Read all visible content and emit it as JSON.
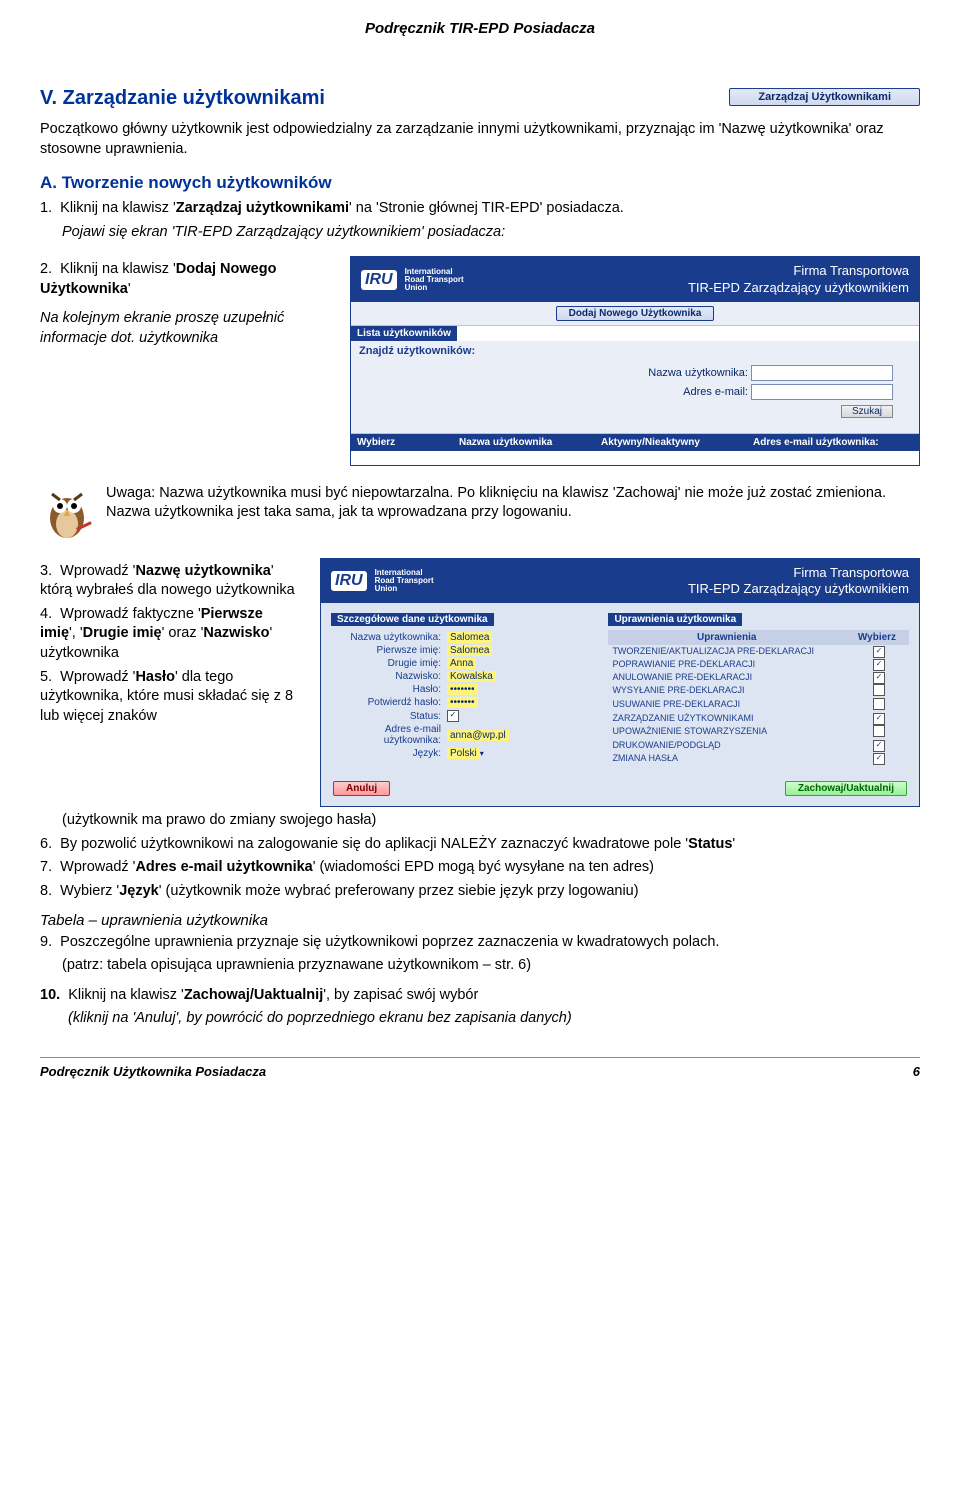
{
  "header": {
    "title": "Podręcznik TIR-EPD Posiadacza"
  },
  "section_v": {
    "heading": "V.  Zarządzanie użytkownikami",
    "manage_button": "Zarządzaj Użytkownikami",
    "intro": "Początkowo główny użytkownik jest odpowiedzialny za zarządzanie innymi użytkownikami, przyznając im 'Nazwę użytkownika' oraz stosowne uprawnienia."
  },
  "section_a": {
    "heading": "A.  Tworzenie nowych użytkowników",
    "step1_pre": "Kliknij na klawisz '",
    "step1_bold": "Zarządzaj użytkownikami",
    "step1_post": "' na 'Stronie głównej TIR-EPD' posiadacza.",
    "step1_result": "Pojawi się ekran 'TIR-EPD Zarządzający użytkownikiem' posiadacza:",
    "step2_pre": "Kliknij na klawisz '",
    "step2_bold": "Dodaj Nowego Użytkownika",
    "step2_after": "Na kolejnym ekranie proszę uzupełnić informacje dot. użytkownika"
  },
  "iru1": {
    "logo": "IRU",
    "logo_sub1": "International",
    "logo_sub2": "Road Transport",
    "logo_sub3": "Union",
    "firm": "Firma Transportowa",
    "subtitle": "TIR-EPD Zarządzający użytkownikiem",
    "add_user_btn": "Dodaj Nowego Użytkownika",
    "list_label": "Lista użytkowników",
    "find_label": "Znajdź użytkowników:",
    "name_label": "Nazwa użytkownika:",
    "email_label": "Adres e-mail:",
    "search_btn": "Szukaj",
    "th1": "Wybierz",
    "th2": "Nazwa użytkownika",
    "th3": "Aktywny/Nieaktywny",
    "th4": "Adres e-mail użytkownika:"
  },
  "note": {
    "label": "Uwaga:",
    "text": "Nazwa użytkownika musi być niepowtarzalna. Po kliknięciu na klawisz 'Zachowaj' nie może już zostać zmieniona. Nazwa użytkownika jest taka sama, jak ta wprowadzana przy logowaniu."
  },
  "steps_list": {
    "s3_pre": "Wprowadź '",
    "s3_bold": "Nazwę użytkownika",
    "s3_post": "' którą wybrałeś dla nowego użytkownika",
    "s4_pre": "Wprowadź faktyczne '",
    "s4_b1": "Pierwsze imię",
    "s4_mid1": "', '",
    "s4_b2": "Drugie imię",
    "s4_mid2": "' oraz '",
    "s4_b3": "Nazwisko",
    "s4_post": "' użytkownika",
    "s5_pre": "Wprowadź '",
    "s5_bold": "Hasło",
    "s5_post": "' dla tego użytkownika, które musi składać się z 8 lub więcej znaków",
    "s5_paren": "(użytkownik ma prawo do zmiany swojego hasła)",
    "s6_pre": "By pozwolić użytkownikowi na zalogowanie się do aplikacji NALEŻY zaznaczyć kwadratowe pole '",
    "s6_bold": "Status",
    "s6_post": "'",
    "s7_pre": "Wprowadź '",
    "s7_bold": "Adres e-mail użytkownika",
    "s7_post": "' (wiadomości EPD mogą być wysyłane na ten adres)",
    "s8_pre": "Wybierz '",
    "s8_bold": "Język",
    "s8_post": "' (użytkownik może wybrać preferowany przez siebie język przy logowaniu)"
  },
  "table_heading": "Tabela – uprawnienia użytkownika",
  "step9": "Poszczególne uprawnienia przyznaje się użytkownikowi poprzez zaznaczenia w kwadratowych polach.",
  "step9_paren": "(patrz: tabela opisująca uprawnienia przyznawane użytkownikom – str. 6)",
  "step10_pre": "Kliknij na klawisz '",
  "step10_bold": "Zachowaj/Uaktualnij",
  "step10_post": "', by zapisać swój wybór",
  "step10_paren": "(kliknij na 'Anuluj', by powrócić do poprzedniego ekranu bez zapisania danych)",
  "iru2": {
    "firm": "Firma Transportowa",
    "subtitle": "TIR-EPD Zarządzający użytkownikiem",
    "details_tag": "Szczegółowe dane użytkownika",
    "perm_tag": "Uprawnienia użytkownika",
    "fields": {
      "username_l": "Nazwa użytkownika:",
      "username_v": "Salomea",
      "first_l": "Pierwsze imię:",
      "first_v": "Salomea",
      "second_l": "Drugie imię:",
      "second_v": "Anna",
      "last_l": "Nazwisko:",
      "last_v": "Kowalska",
      "pass_l": "Hasło:",
      "pass_v": "•••••••",
      "pass2_l": "Potwierdź hasło:",
      "pass2_v": "•••••••",
      "status_l": "Status:",
      "email_l": "Adres e-mail użytkownika:",
      "email_v": "anna@wp.pl",
      "lang_l": "Język:",
      "lang_v": "Polski"
    },
    "perm_head_l": "Uprawnienia",
    "perm_head_r": "Wybierz",
    "perms": [
      {
        "label": "TWORZENIE/AKTUALIZACJA PRE-DEKLARACJI",
        "checked": true
      },
      {
        "label": "POPRAWIANIE PRE-DEKLARACJI",
        "checked": true
      },
      {
        "label": "ANULOWANIE PRE-DEKLARACJI",
        "checked": true
      },
      {
        "label": "WYSYŁANIE PRE-DEKLARACJI",
        "checked": false
      },
      {
        "label": "USUWANIE PRE-DEKLARACJI",
        "checked": false
      },
      {
        "label": "ZARZĄDZANIE UŻYTKOWNIKAMI",
        "checked": true
      },
      {
        "label": "UPOWAŻNIENIE STOWARZYSZENIA",
        "checked": false
      },
      {
        "label": "DRUKOWANIE/PODGLĄD",
        "checked": true
      },
      {
        "label": "ZMIANA HASŁA",
        "checked": true
      }
    ],
    "btn_cancel": "Anuluj",
    "btn_save": "Zachowaj/Uaktualnij"
  },
  "footer": {
    "left": "Podręcznik Użytkownika Posiadacza",
    "right": "6"
  }
}
